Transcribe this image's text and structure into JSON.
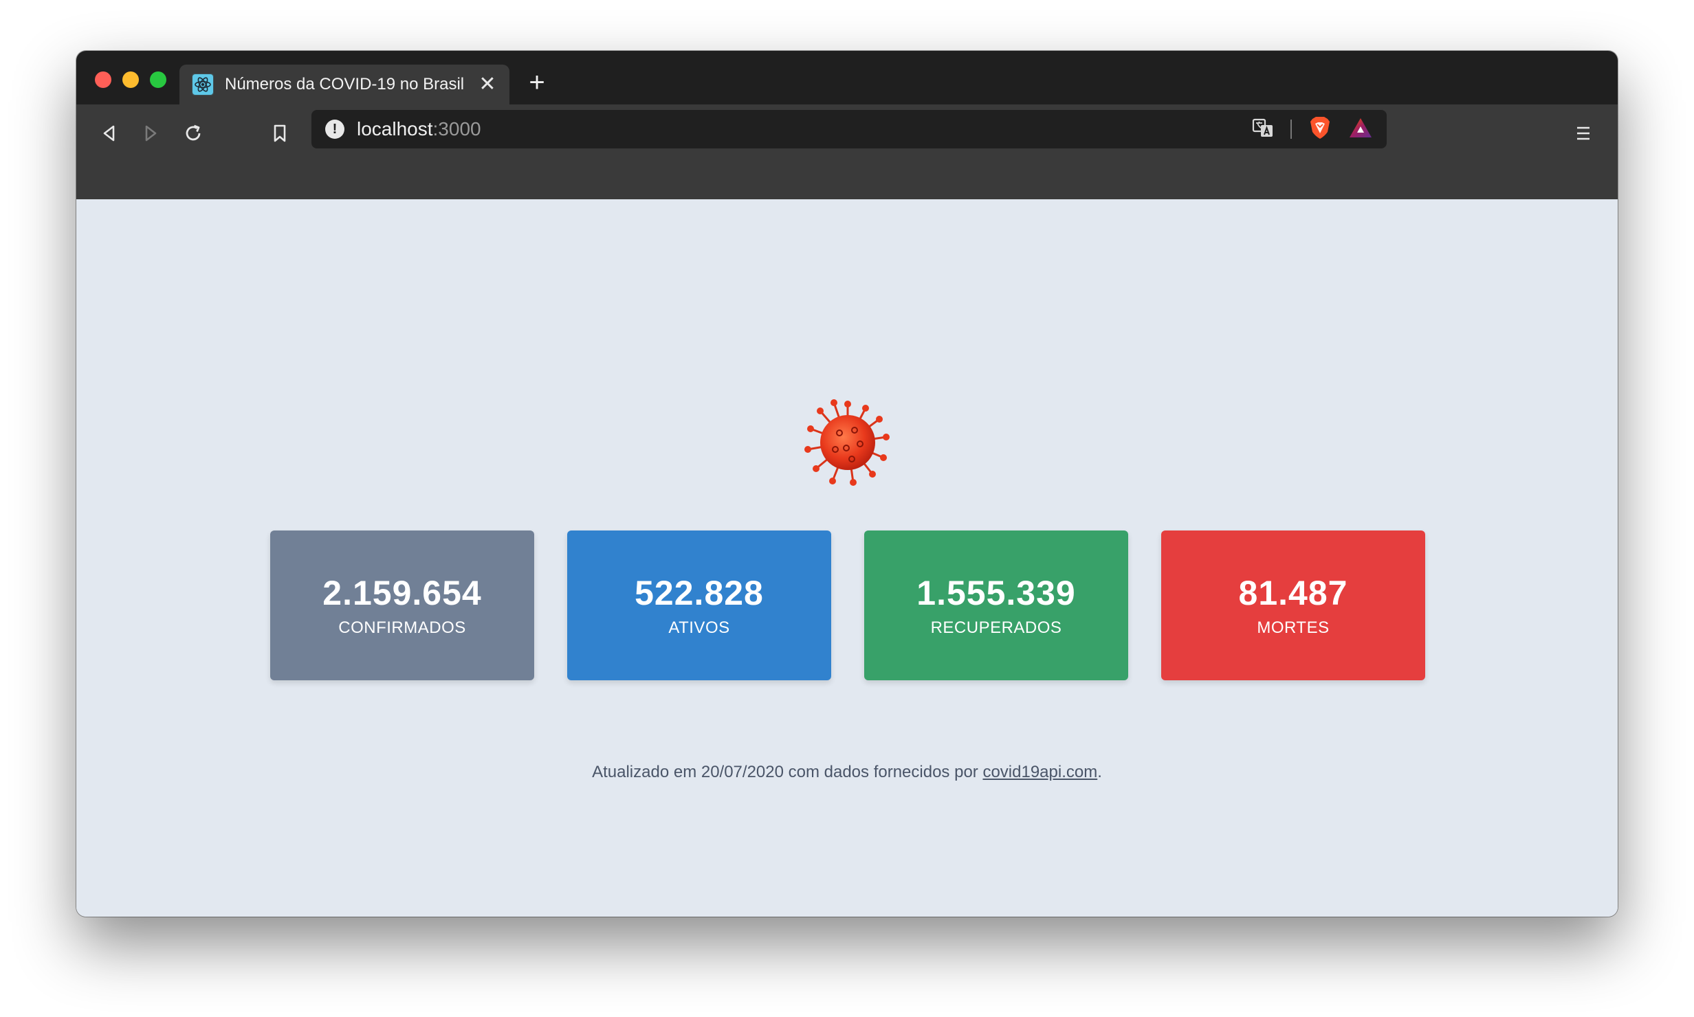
{
  "tab": {
    "title": "Números da COVID-19 no Brasil",
    "close": "✕",
    "new_tab": "+"
  },
  "omnibox": {
    "host": "localhost",
    "port": ":3000"
  },
  "icons": {
    "favicon": "react-icon",
    "back": "back-arrow-icon",
    "forward": "forward-arrow-icon",
    "reload": "reload-icon",
    "bookmark": "bookmark-icon",
    "info": "info-icon",
    "translate": "translate-icon",
    "brave": "brave-shield-icon",
    "rewards": "brave-rewards-icon",
    "menu": "hamburger-menu-icon",
    "virus": "virus-icon"
  },
  "colors": {
    "confirmados": "#718096",
    "ativos": "#3182ce",
    "recuperados": "#38a169",
    "mortes": "#e53e3e",
    "page_bg": "#e2e8f0"
  },
  "stats": [
    {
      "value": "2.159.654",
      "label": "CONFIRMADOS"
    },
    {
      "value": "522.828",
      "label": "ATIVOS"
    },
    {
      "value": "1.555.339",
      "label": "RECUPERADOS"
    },
    {
      "value": "81.487",
      "label": "MORTES"
    }
  ],
  "footer": {
    "prefix": "Atualizado em 20/07/2020 com dados fornecidos por ",
    "link": "covid19api.com",
    "suffix": "."
  }
}
